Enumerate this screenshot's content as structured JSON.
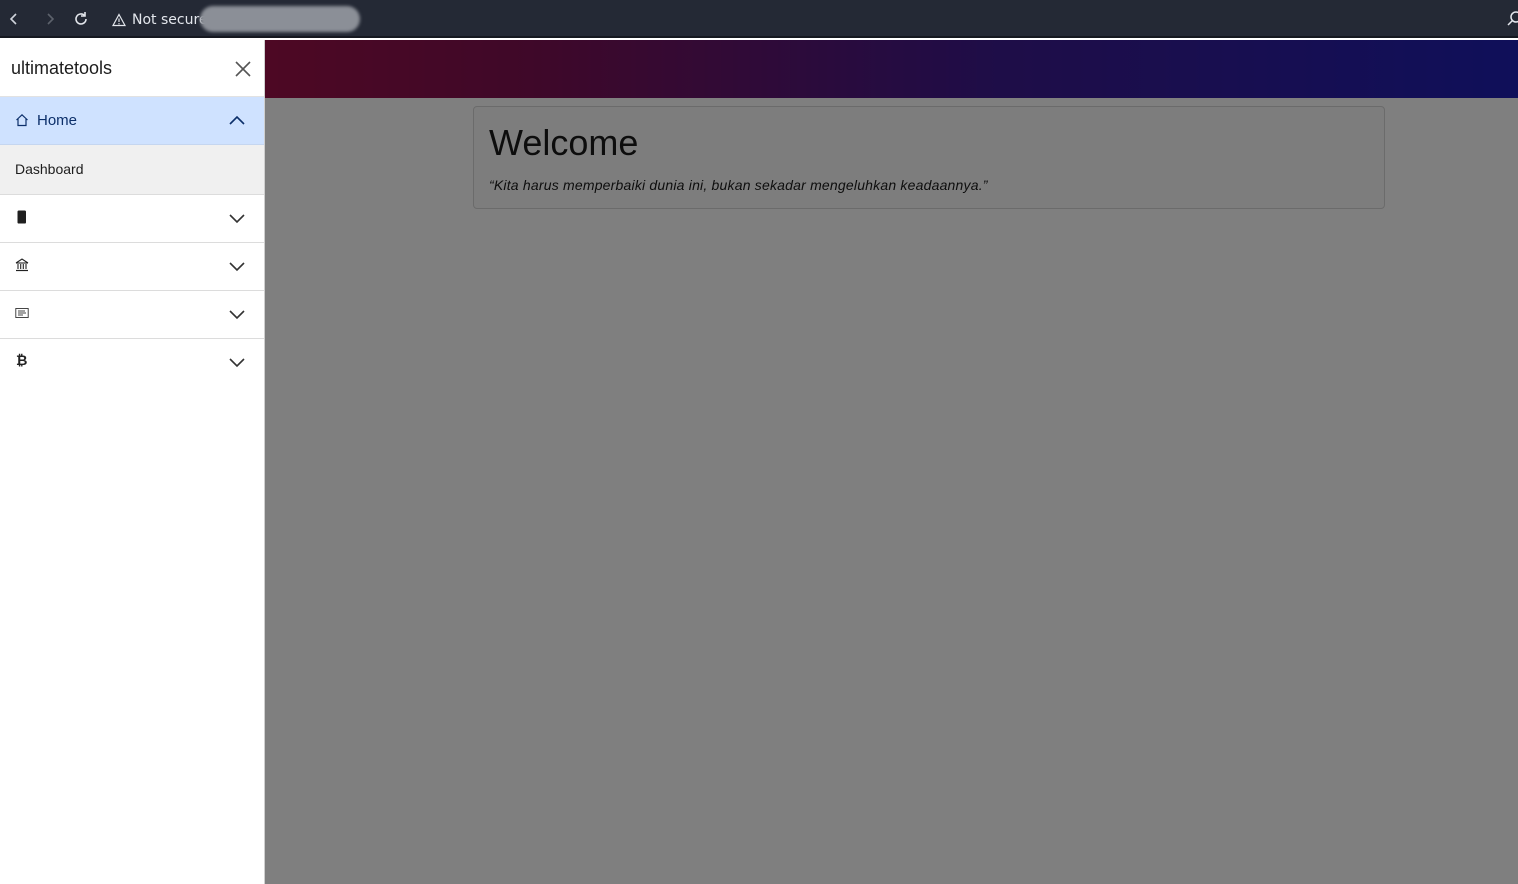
{
  "browser": {
    "back_icon": "chevron-left-icon",
    "forward_icon": "chevron-right-icon",
    "reload_icon": "reload-icon",
    "security_text": "Not secure",
    "security_icon": "warning-triangle-icon",
    "zoom_icon": "search-icon"
  },
  "colors": {
    "navbar_gradient_start": "#b8113d",
    "navbar_gradient_end": "#1f1fb4",
    "active_item_bg": "#cfe2ff"
  },
  "sidebar": {
    "title": "ultimatetools",
    "close_icon": "close-icon",
    "items": [
      {
        "icon": "home-icon",
        "label": "Home",
        "expanded": true,
        "sub_items": [
          "Dashboard"
        ]
      },
      {
        "icon": "phone-icon",
        "label": "",
        "expanded": false
      },
      {
        "icon": "bank-icon",
        "label": "",
        "expanded": false
      },
      {
        "icon": "list-icon",
        "label": "",
        "expanded": false
      },
      {
        "icon": "bitcoin-icon",
        "label": "",
        "expanded": false
      }
    ]
  },
  "main": {
    "welcome_title": "Welcome",
    "quote": "“Kita harus memperbaiki dunia ini, bukan sekadar mengeluhkan keadaannya.”"
  }
}
